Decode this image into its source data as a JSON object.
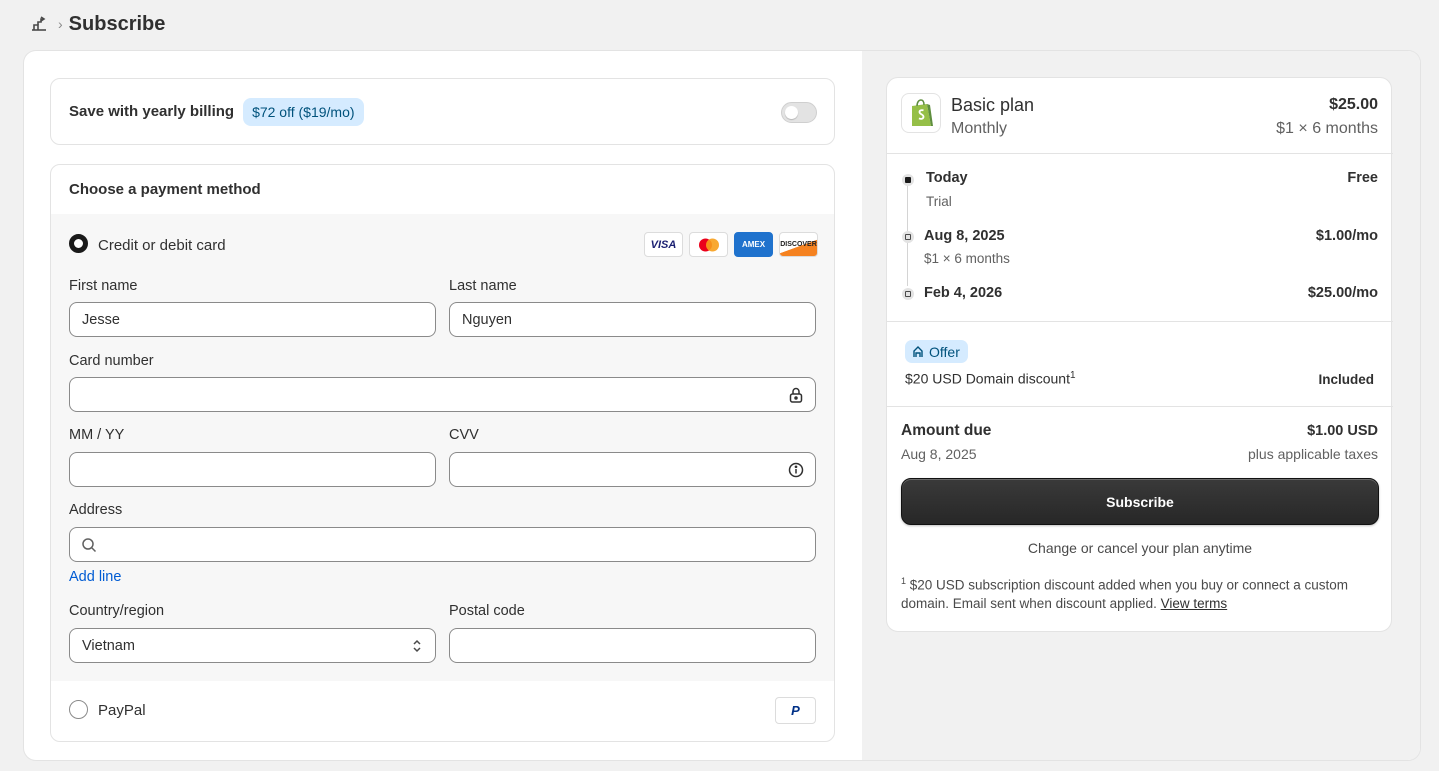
{
  "header": {
    "title": "Subscribe"
  },
  "yearly": {
    "label": "Save with yearly billing",
    "badge": "$72 off ($19/mo)",
    "toggle_on": false
  },
  "payment": {
    "title": "Choose a payment method",
    "card_option": {
      "label": "Credit or debit card",
      "selected": true
    },
    "card_brands": [
      "VISA",
      "MC",
      "AMEX",
      "DISCOVER"
    ],
    "first_name": {
      "label": "First name",
      "value": "Jesse"
    },
    "last_name": {
      "label": "Last name",
      "value": "Nguyen"
    },
    "card_number": {
      "label": "Card number",
      "value": ""
    },
    "expiry": {
      "label": "MM / YY",
      "value": ""
    },
    "cvv": {
      "label": "CVV",
      "value": ""
    },
    "address": {
      "label": "Address",
      "value": ""
    },
    "add_line": "Add line",
    "country": {
      "label": "Country/region",
      "value": "Vietnam"
    },
    "postal": {
      "label": "Postal code",
      "value": ""
    },
    "paypal_option": {
      "label": "PayPal",
      "selected": false,
      "logo": "P"
    }
  },
  "summary": {
    "plan_name": "Basic plan",
    "plan_cycle": "Monthly",
    "plan_price": "$25.00",
    "plan_terms": "$1 × 6 months",
    "timeline": [
      {
        "label": "Today",
        "sub": "Trial",
        "value": "Free"
      },
      {
        "label": "Aug 8, 2025",
        "sub": "$1 × 6 months",
        "value": "$1.00/mo"
      },
      {
        "label": "Feb 4, 2026",
        "sub": "",
        "value": "$25.00/mo"
      }
    ],
    "offer": {
      "badge": "Offer",
      "text": "$20 USD Domain discount",
      "sup": "1",
      "value": "Included"
    },
    "due": {
      "label": "Amount due",
      "date": "Aug 8, 2025",
      "value": "$1.00 USD",
      "tax": "plus applicable taxes"
    },
    "subscribe_label": "Subscribe",
    "change_note": "Change or cancel your plan anytime",
    "footnote": {
      "sup": "1",
      "text": " $20 USD subscription discount added when you buy or connect a custom domain. Email sent when discount applied. ",
      "link": "View terms"
    }
  },
  "colors": {
    "accent_link": "#005bd3",
    "badge_bg": "#d5ebff",
    "badge_text": "#00527c",
    "button_dark": "#303030",
    "brand_green": "#95bf47"
  }
}
